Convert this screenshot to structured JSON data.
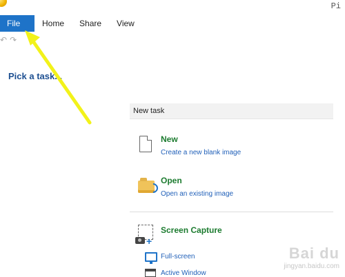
{
  "titlebar": {
    "title_fragment": "Pi"
  },
  "tabs": [
    {
      "label": "File",
      "active": true
    },
    {
      "label": "Home"
    },
    {
      "label": "Share"
    },
    {
      "label": "View"
    }
  ],
  "quick_access": {
    "undo": "↶",
    "redo": "↷",
    "dropdown": "▾"
  },
  "sidebar": {
    "pick_task": "Pick a task..."
  },
  "panel": {
    "section_title": "New task",
    "items": [
      {
        "title": "New",
        "link": "Create a new blank image",
        "icon": "blank-document-icon"
      },
      {
        "title": "Open",
        "link": "Open an existing image",
        "icon": "folder-open-icon"
      },
      {
        "title": "Screen Capture",
        "icon": "screen-capture-icon",
        "sub": [
          {
            "label": "Full-screen",
            "icon": "monitor-icon"
          },
          {
            "label": "Active Window",
            "icon": "window-icon"
          }
        ]
      }
    ]
  },
  "watermark": {
    "brand": "Bai du",
    "site": "jingyan.baidu.com"
  },
  "colors": {
    "file_tab": "#1e73c8",
    "title_green": "#1c7b2f",
    "link_blue": "#1f5fb8",
    "annotation": "#f2f21a"
  }
}
